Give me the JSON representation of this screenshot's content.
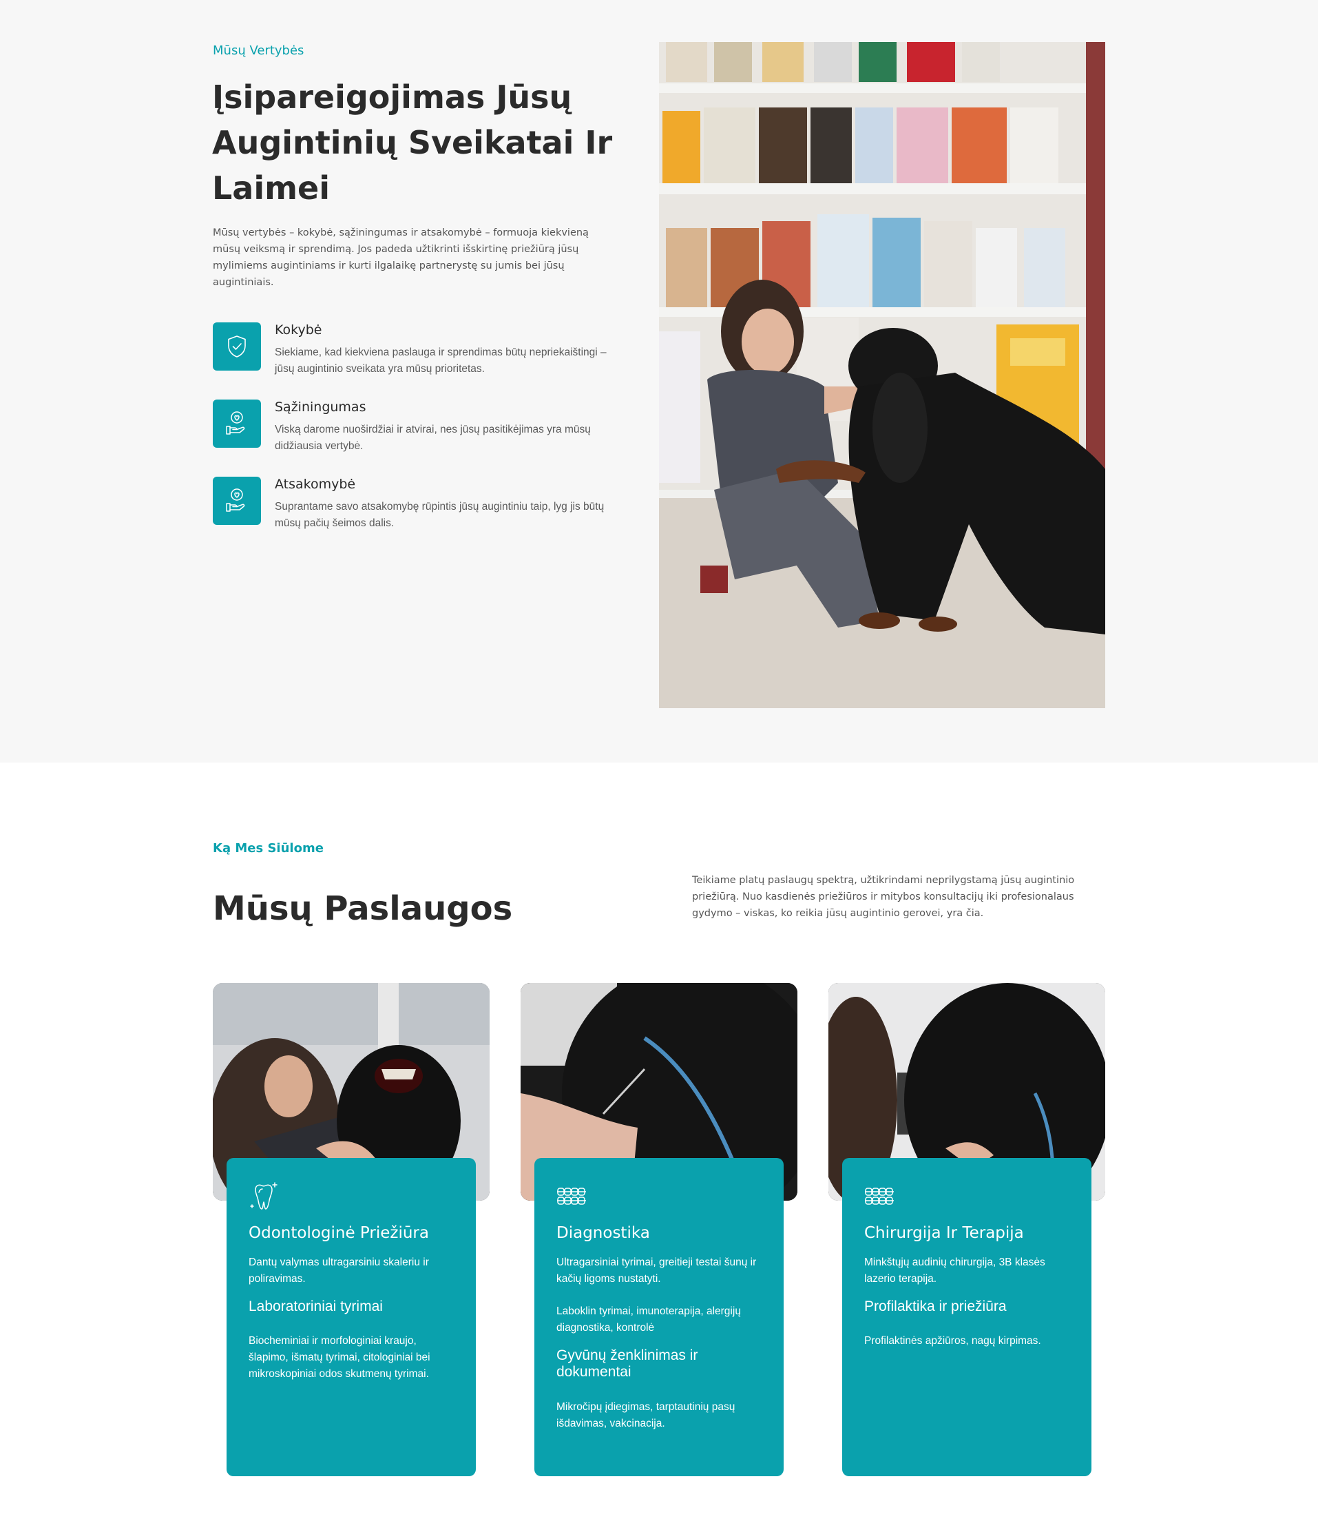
{
  "values_section": {
    "eyebrow": "Mūsų Vertybės",
    "title": "Įsipareigojimas Jūsų Augintinių Sveikatai Ir Laimei",
    "intro": "Mūsų vertybės – kokybė, sąžiningumas ir atsakomybė – formuoja kiekvieną mūsų veiksmą ir sprendimą. Jos padeda užtikrinti išskirtinę priežiūrą jūsų mylimiems augintiniams ir kurti ilgalaikę partnerystę su jumis bei jūsų augintiniais.",
    "items": [
      {
        "icon": "shield-check-icon",
        "title": "Kokybė",
        "text": "Siekiame, kad kiekviena paslauga ir sprendimas būtų nepriekaištingi – jūsų augintinio sveikata yra mūsų prioritetas."
      },
      {
        "icon": "heart-hand-icon",
        "title": "Sąžiningumas",
        "text": "Viską darome nuoširdžiai ir atvirai, nes jūsų pasitikėjimas yra mūsų didžiausia vertybė."
      },
      {
        "icon": "heart-hand-icon",
        "title": "Atsakomybė",
        "text": "Suprantame savo atsakomybę rūpintis jūsų augintiniu taip, lyg jis būtų mūsų pačių šeimos dalis."
      }
    ],
    "photo": "vet-with-black-dog-photo"
  },
  "services_section": {
    "eyebrow": "Ką Mes Siūlome",
    "title": "Mūsų Paslaugos",
    "lead": "Teikiame platų paslaugų spektrą, užtikrindami neprilygstamą jūsų augintinio priežiūrą. Nuo kasdienės priežiūros ir mitybos konsultacijų iki profesionalaus gydymo – viskas, ko reikia jūsų augintinio gerovei, yra čia.",
    "cards": [
      {
        "icon": "tooth-icon",
        "title": "Odontologinė Priežiūra",
        "blocks": [
          {
            "type": "text",
            "value": "Dantų valymas ultragarsiniu skaleriu ir poliravimas."
          },
          {
            "type": "sub",
            "value": "Laboratoriniai tyrimai"
          },
          {
            "type": "text",
            "value": "Biocheminiai ir morfologiniai kraujo, šlapimo, išmatų tyrimai, citologiniai bei mikroskopiniai odos skutmenų tyrimai."
          }
        ]
      },
      {
        "icon": "teeth-braces-icon",
        "title": "Diagnostika",
        "blocks": [
          {
            "type": "text",
            "value": "Ultragarsiniai tyrimai, greitieji testai šunų ir kačių ligoms nustatyti."
          },
          {
            "type": "text",
            "value": "Laboklin tyrimai, imunoterapija, alergijų diagnostika, kontrolė"
          },
          {
            "type": "sub",
            "value": "Gyvūnų ženklinimas ir dokumentai"
          },
          {
            "type": "text",
            "value": "Mikročipų įdiegimas, tarptautinių pasų išdavimas, vakcinacija."
          }
        ]
      },
      {
        "icon": "teeth-braces-icon",
        "title": "Chirurgija Ir Terapija",
        "blocks": [
          {
            "type": "text",
            "value": "Minkštųjų audinių chirurgija, 3B klasės lazerio terapija."
          },
          {
            "type": "sub",
            "value": "Profilaktika ir priežiūra"
          },
          {
            "type": "text",
            "value": "Profilaktinės apžiūros, nagų kirpimas."
          }
        ]
      }
    ]
  },
  "colors": {
    "accent": "#0aa1ad",
    "heading": "#2b2b2b",
    "section_bg": "#f7f7f7"
  }
}
